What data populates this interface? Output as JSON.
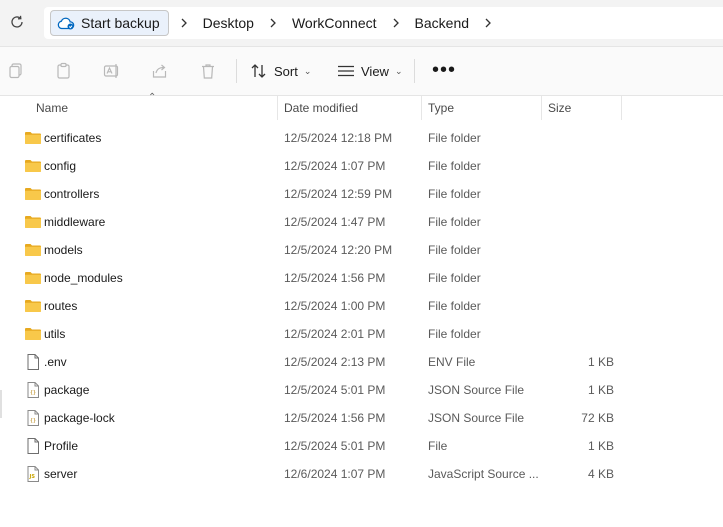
{
  "breadcrumb": {
    "start_backup": "Start backup",
    "items": [
      "Desktop",
      "WorkConnect",
      "Backend"
    ]
  },
  "toolbar": {
    "sort_label": "Sort",
    "view_label": "View",
    "more_label": "•••"
  },
  "columns": {
    "name": "Name",
    "date": "Date modified",
    "type": "Type",
    "size": "Size"
  },
  "files": [
    {
      "name": "certificates",
      "date": "12/5/2024 12:18 PM",
      "type": "File folder",
      "size": "",
      "icon": "folder-icon"
    },
    {
      "name": "config",
      "date": "12/5/2024 1:07 PM",
      "type": "File folder",
      "size": "",
      "icon": "folder-icon"
    },
    {
      "name": "controllers",
      "date": "12/5/2024 12:59 PM",
      "type": "File folder",
      "size": "",
      "icon": "folder-icon"
    },
    {
      "name": "middleware",
      "date": "12/5/2024 1:47 PM",
      "type": "File folder",
      "size": "",
      "icon": "folder-icon"
    },
    {
      "name": "models",
      "date": "12/5/2024 12:20 PM",
      "type": "File folder",
      "size": "",
      "icon": "folder-icon"
    },
    {
      "name": "node_modules",
      "date": "12/5/2024 1:56 PM",
      "type": "File folder",
      "size": "",
      "icon": "folder-icon"
    },
    {
      "name": "routes",
      "date": "12/5/2024 1:00 PM",
      "type": "File folder",
      "size": "",
      "icon": "folder-icon"
    },
    {
      "name": "utils",
      "date": "12/5/2024 2:01 PM",
      "type": "File folder",
      "size": "",
      "icon": "folder-icon"
    },
    {
      "name": ".env",
      "date": "12/5/2024 2:13 PM",
      "type": "ENV File",
      "size": "1 KB",
      "icon": "file-icon"
    },
    {
      "name": "package",
      "date": "12/5/2024 5:01 PM",
      "type": "JSON Source File",
      "size": "1 KB",
      "icon": "json-file-icon"
    },
    {
      "name": "package-lock",
      "date": "12/5/2024 1:56 PM",
      "type": "JSON Source File",
      "size": "72 KB",
      "icon": "json-file-icon"
    },
    {
      "name": "Profile",
      "date": "12/5/2024 5:01 PM",
      "type": "File",
      "size": "1 KB",
      "icon": "file-icon"
    },
    {
      "name": "server",
      "date": "12/6/2024 1:07 PM",
      "type": "JavaScript Source ...",
      "size": "4 KB",
      "icon": "js-file-icon"
    }
  ],
  "colors": {
    "folder": "#f8c84a",
    "folder_dark": "#e7a91f",
    "accent": "#0067c0",
    "disabled_icon": "#b8b8b8"
  }
}
